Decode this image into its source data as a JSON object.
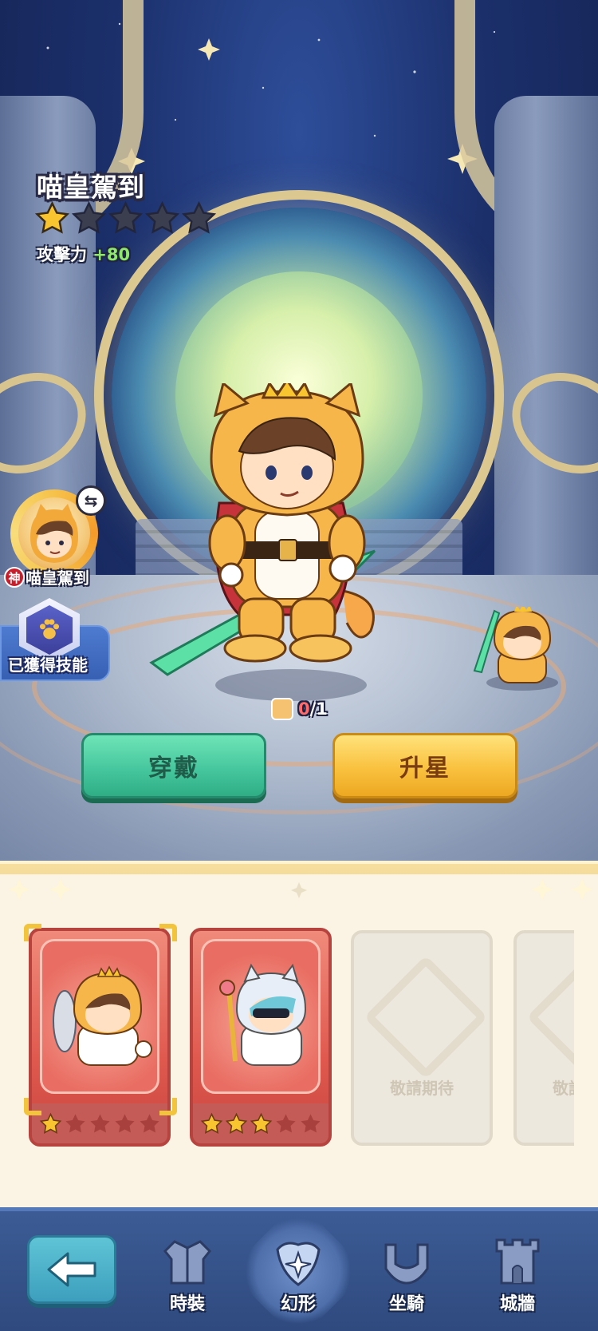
{
  "hero": {
    "name": "喵皇駕到",
    "star_count": 1,
    "star_max": 5,
    "attack_label": "攻擊力",
    "attack_bonus": "+80"
  },
  "side": {
    "avatar_name": "喵皇駕到",
    "god_badge": "神",
    "skill_label": "已獲得技能"
  },
  "shards": {
    "have": "0",
    "need": "/1"
  },
  "actions": {
    "wear_label": "穿戴",
    "upgrade_label": "升星"
  },
  "cards": [
    {
      "type": "owned",
      "stars": 1,
      "max": 5
    },
    {
      "type": "owned",
      "stars": 3,
      "max": 5
    },
    {
      "type": "empty",
      "label": "敬請期待"
    },
    {
      "type": "empty",
      "label": "敬請期待"
    }
  ],
  "nav": {
    "items": [
      {
        "label": "時裝",
        "icon": "costume-icon",
        "active": false
      },
      {
        "label": "幻形",
        "icon": "transform-icon",
        "active": true
      },
      {
        "label": "坐騎",
        "icon": "mount-icon",
        "active": false
      },
      {
        "label": "城牆",
        "icon": "castle-wall-icon",
        "active": false
      }
    ]
  },
  "colors": {
    "star_on": "#f8c530",
    "star_off": "#3a3e4f",
    "attack_bonus": "#8fe86b",
    "wear_button": "#47c79e",
    "upgrade_button": "#f9c13f"
  }
}
